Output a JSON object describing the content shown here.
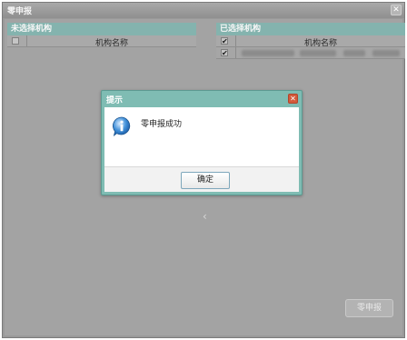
{
  "window": {
    "title": "零申报",
    "close_glyph": "✕"
  },
  "left_panel": {
    "header": "未选择机构",
    "column_header": "机构名称"
  },
  "right_panel": {
    "header": "已选择机构",
    "column_header": "机构名称",
    "rows": [
      {
        "checked": true
      }
    ]
  },
  "arrow_glyph": "‹",
  "submit_button": {
    "label": "零申报"
  },
  "dialog": {
    "title": "提示",
    "close_glyph": "✕",
    "icon": "info-icon",
    "message": "零申报成功",
    "ok_label": "确定"
  },
  "colors": {
    "panel_header": "#84b3ae",
    "dialog_frame": "#7fbcb3",
    "dialog_close": "#d45a3b",
    "overlay_gray": "#a3a3a3"
  }
}
